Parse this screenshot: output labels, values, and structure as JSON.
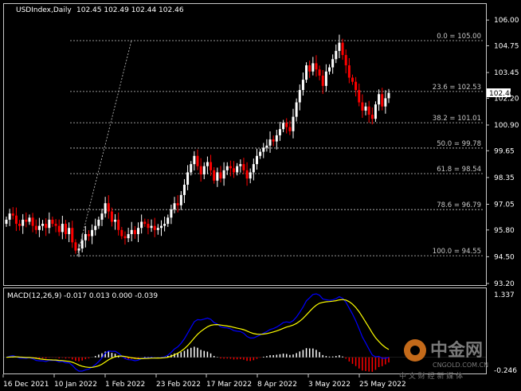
{
  "symbol_header": "USDIndex,Daily",
  "ohlc": "102.45 102.49 102.44 102.46",
  "macd_header": "MACD(12,26,9)",
  "macd_values": "-0.017 0.013 0.000 -0.039",
  "current_price": "102.46",
  "watermark": {
    "brand": "中金网",
    "site": "CNGOLD.COM.CN",
    "tagline": "中 文 财 经 新 媒 体"
  },
  "colors": {
    "bull": "#ffffff",
    "bear": "#ff0000",
    "macd_main": "#0000ff",
    "macd_signal": "#ffff00",
    "grid": "#c8c8c8"
  },
  "chart_data": [
    {
      "type": "candlestick",
      "title": "USDIndex,Daily",
      "ylim": [
        93.2,
        106.2
      ],
      "price_ticks": [
        "106.00",
        "104.75",
        "103.45",
        "102.20",
        "100.90",
        "99.65",
        "98.35",
        "97.05",
        "95.80",
        "94.50",
        "93.20"
      ],
      "date_ticks": [
        "16 Dec 2021",
        "10 Jan 2022",
        "1 Feb 2022",
        "23 Feb 2022",
        "17 Mar 2022",
        "8 Apr 2022",
        "3 May 2022",
        "25 May 2022"
      ],
      "fib_levels": [
        {
          "label": "0.0 = 105.00",
          "value": 105.0
        },
        {
          "label": "23.6 = 102.53",
          "value": 102.53
        },
        {
          "label": "38.2 = 101.01",
          "value": 101.01
        },
        {
          "label": "50.0 = 99.78",
          "value": 99.78
        },
        {
          "label": "61.8 = 98.54",
          "value": 98.54
        },
        {
          "label": "78.6 = 96.79",
          "value": 96.79
        },
        {
          "label": "100.0 = 94.55",
          "value": 94.55
        }
      ],
      "trendline": {
        "from": [
          94.55
        ],
        "to": [
          105.0
        ]
      },
      "closes": [
        96.3,
        96.6,
        96.5,
        96.1,
        96.0,
        96.3,
        96.2,
        96.4,
        96.0,
        95.8,
        96.0,
        96.1,
        95.9,
        96.3,
        96.1,
        96.0,
        95.7,
        96.1,
        95.6,
        95.9,
        95.2,
        94.8,
        94.9,
        95.3,
        95.6,
        95.5,
        95.8,
        96.0,
        96.3,
        96.6,
        97.1,
        96.7,
        96.2,
        96.3,
        95.8,
        95.5,
        95.4,
        95.6,
        95.8,
        95.6,
        95.9,
        96.2,
        96.1,
        95.9,
        96.0,
        95.8,
        95.9,
        96.0,
        96.1,
        96.4,
        96.8,
        97.1,
        97.0,
        97.5,
        98.0,
        98.6,
        99.0,
        99.4,
        98.9,
        98.5,
        98.9,
        99.1,
        98.7,
        98.2,
        98.6,
        98.3,
        98.7,
        98.9,
        98.8,
        98.6,
        98.9,
        99.0,
        98.7,
        98.3,
        98.6,
        99.0,
        99.4,
        99.6,
        99.8,
        99.9,
        100.2,
        100.1,
        100.4,
        100.7,
        101.0,
        100.8,
        100.6,
        101.3,
        102.0,
        102.6,
        103.1,
        103.8,
        103.5,
        103.9,
        103.6,
        103.3,
        102.8,
        103.5,
        103.7,
        104.1,
        104.5,
        104.9,
        104.3,
        103.8,
        103.2,
        103.0,
        102.6,
        102.0,
        101.6,
        101.8,
        101.4,
        101.2,
        101.9,
        102.4,
        101.8,
        102.2,
        102.46
      ],
      "macd_ylim": [
        -0.246,
        1.337
      ],
      "macd_ticks": [
        "1.337",
        "-0.246"
      ]
    }
  ]
}
